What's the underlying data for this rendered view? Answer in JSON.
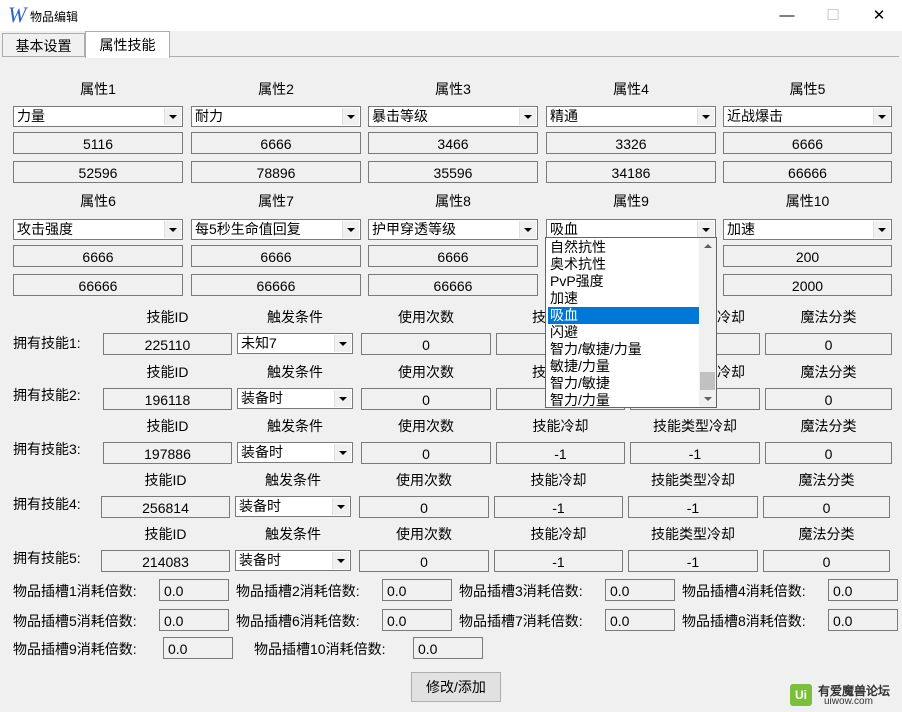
{
  "window": {
    "title": "物品编辑",
    "app_icon": "W",
    "min": "—",
    "max": "☐",
    "close": "✕"
  },
  "tabs": [
    {
      "label": "基本设置"
    },
    {
      "label": "属性技能"
    }
  ],
  "attrs": [
    {
      "label": "属性1",
      "combo": "力量",
      "v1": "5116",
      "v2": "52596"
    },
    {
      "label": "属性2",
      "combo": "耐力",
      "v1": "6666",
      "v2": "78896"
    },
    {
      "label": "属性3",
      "combo": "暴击等级",
      "v1": "3466",
      "v2": "35596"
    },
    {
      "label": "属性4",
      "combo": "精通",
      "v1": "3326",
      "v2": "34186"
    },
    {
      "label": "属性5",
      "combo": "近战爆击",
      "v1": "6666",
      "v2": "66666"
    },
    {
      "label": "属性6",
      "combo": "攻击强度",
      "v1": "6666",
      "v2": "66666"
    },
    {
      "label": "属性7",
      "combo": "每5秒生命值回复",
      "v1": "6666",
      "v2": "66666"
    },
    {
      "label": "属性8",
      "combo": "护甲穿透等级",
      "v1": "6666",
      "v2": "66666"
    },
    {
      "label": "属性9",
      "combo": "吸血",
      "v1": "",
      "v2": ""
    },
    {
      "label": "属性10",
      "combo": "加速",
      "v1": "200",
      "v2": "2000"
    }
  ],
  "dropdown": {
    "items": [
      "自然抗性",
      "奥术抗性",
      "PvP强度",
      "加速",
      "吸血",
      "闪避",
      "智力/敏捷/力量",
      "敏捷/力量",
      "智力/敏捷",
      "智力/力量"
    ],
    "selected_index": 4
  },
  "skill_headers": {
    "id": "技能ID",
    "trigger": "触发条件",
    "uses": "使用次数",
    "cooldown": "技能冷却",
    "type_cooldown": "技能类型冷却",
    "magic": "魔法分类"
  },
  "skills": [
    {
      "label": "拥有技能1:",
      "id": "225110",
      "trigger": "未知7",
      "uses": "0",
      "cooldown": "",
      "type_cooldown": "",
      "magic": "0"
    },
    {
      "label": "拥有技能2:",
      "id": "196118",
      "trigger": "装备时",
      "uses": "0",
      "cooldown": "",
      "type_cooldown": "",
      "magic": "0"
    },
    {
      "label": "拥有技能3:",
      "id": "197886",
      "trigger": "装备时",
      "uses": "0",
      "cooldown": "-1",
      "type_cooldown": "-1",
      "magic": "0"
    },
    {
      "label": "拥有技能4:",
      "id": "256814",
      "trigger": "装备时",
      "uses": "0",
      "cooldown": "-1",
      "type_cooldown": "-1",
      "magic": "0"
    },
    {
      "label": "拥有技能5:",
      "id": "214083",
      "trigger": "装备时",
      "uses": "0",
      "cooldown": "-1",
      "type_cooldown": "-1",
      "magic": "0"
    }
  ],
  "partial_labels": {
    "c1": "技",
    "c2": "冷却"
  },
  "slots": [
    {
      "label": "物品插槽1消耗倍数:",
      "value": "0.0"
    },
    {
      "label": "物品插槽2消耗倍数:",
      "value": "0.0"
    },
    {
      "label": "物品插槽3消耗倍数:",
      "value": "0.0"
    },
    {
      "label": "物品插槽4消耗倍数:",
      "value": "0.0"
    },
    {
      "label": "物品插槽5消耗倍数:",
      "value": "0.0"
    },
    {
      "label": "物品插槽6消耗倍数:",
      "value": "0.0"
    },
    {
      "label": "物品插槽7消耗倍数:",
      "value": "0.0"
    },
    {
      "label": "物品插槽8消耗倍数:",
      "value": "0.0"
    },
    {
      "label": "物品插槽9消耗倍数:",
      "value": "0.0"
    },
    {
      "label": "物品插槽10消耗倍数:",
      "value": "0.0"
    }
  ],
  "submit_label": "修改/添加",
  "watermark": {
    "logo": "Ui",
    "line1": "有爱魔兽论坛",
    "line2": "uiwow.com"
  }
}
